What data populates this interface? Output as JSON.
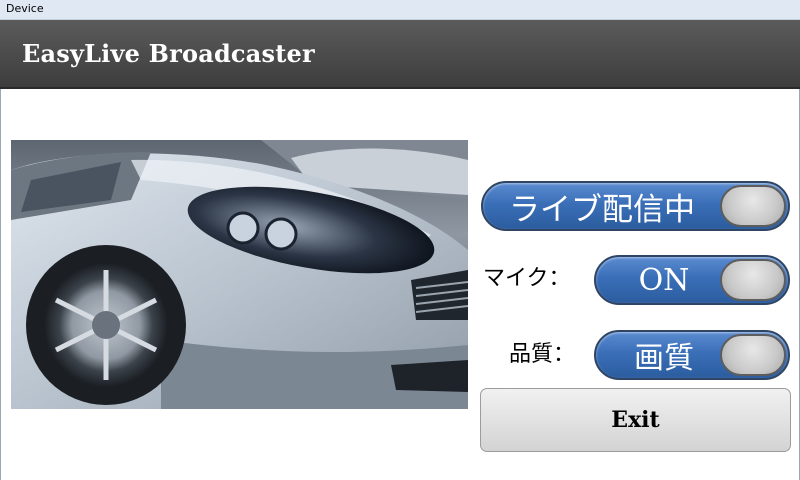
{
  "window": {
    "title": "Device"
  },
  "header": {
    "title": "EasyLive Broadcaster"
  },
  "preview": {
    "image": "car-photo"
  },
  "controls": {
    "live": {
      "label": "ライブ配信中"
    },
    "mic": {
      "field_label": "マイク：",
      "value": "ON"
    },
    "quality": {
      "field_label": "品質：",
      "value": "画質"
    }
  },
  "exit_button": {
    "label": "Exit"
  },
  "colors": {
    "header_bg": "#4a4a4a",
    "toggle_blue": "#3a6fb8",
    "titlebar": "#dfe8f3"
  }
}
